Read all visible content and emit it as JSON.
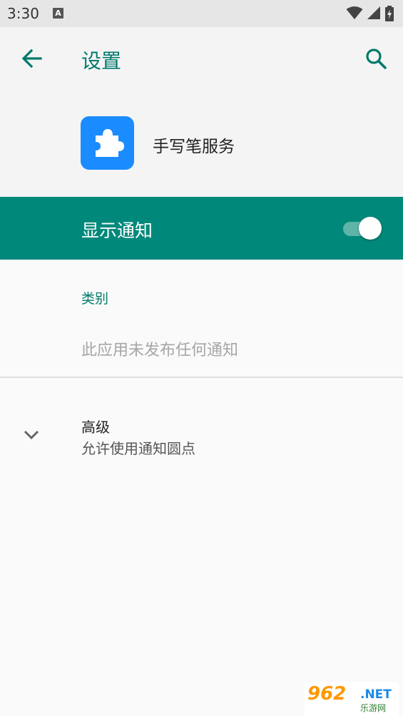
{
  "status_bar": {
    "time": "3:30",
    "notification_icon": "a-icon",
    "icons": [
      "wifi-icon",
      "signal-icon",
      "battery-icon"
    ]
  },
  "app_bar": {
    "title": "设置",
    "back_icon": "arrow-left-icon",
    "search_icon": "search-icon",
    "accent_color": "#00796b"
  },
  "app_header": {
    "app_name": "手写笔服务",
    "icon": "puzzle-icon",
    "icon_color": "#1a8cff"
  },
  "notifications": {
    "toggle_label": "显示通知",
    "toggle_on": true,
    "row_color": "#00897b"
  },
  "category": {
    "heading": "类别",
    "empty_message": "此应用未发布任何通知"
  },
  "advanced": {
    "title": "高级",
    "summary": "允许使用通知圆点",
    "icon": "chevron-down-icon"
  },
  "watermark": {
    "logo": "962",
    "net": ".NET",
    "sub": "乐游网"
  }
}
